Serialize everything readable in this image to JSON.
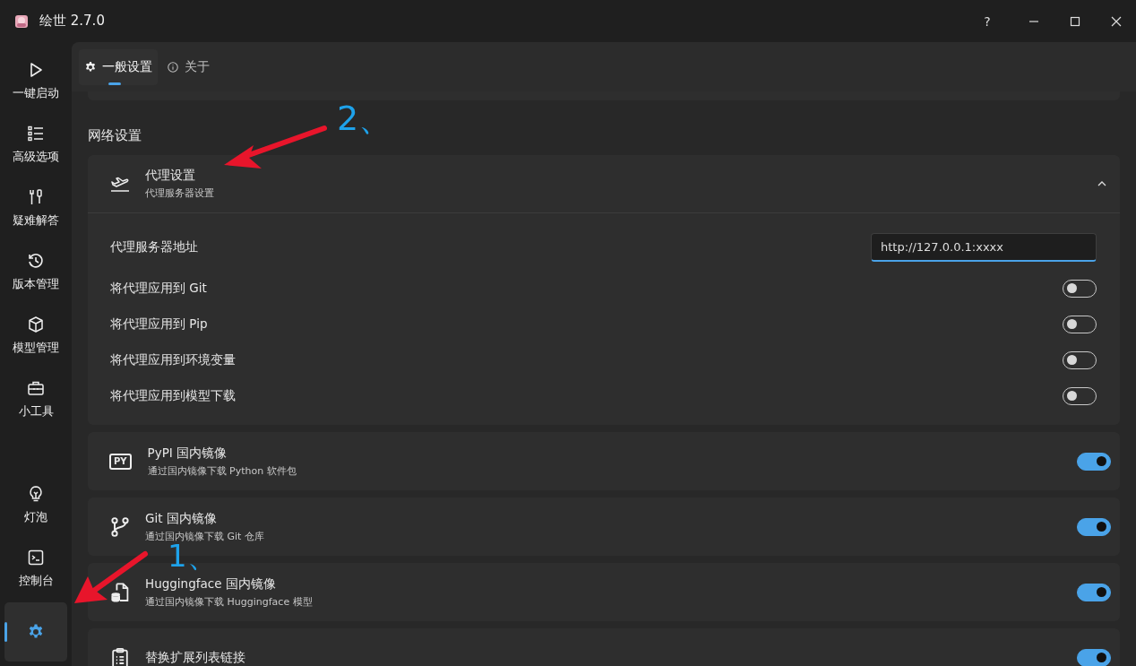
{
  "window": {
    "title": "绘世 2.7.0",
    "help": "?"
  },
  "sidebar": {
    "items": [
      {
        "label": "一键启动",
        "selected": false
      },
      {
        "label": "高级选项",
        "selected": false
      },
      {
        "label": "疑难解答",
        "selected": false
      },
      {
        "label": "版本管理",
        "selected": false
      },
      {
        "label": "模型管理",
        "selected": false
      },
      {
        "label": "小工具",
        "selected": false
      }
    ],
    "bottom_items": [
      {
        "label": "灯泡",
        "selected": false
      },
      {
        "label": "控制台",
        "selected": false
      },
      {
        "selected": true
      }
    ]
  },
  "tabs": [
    {
      "label": "一般设置",
      "selected": true
    },
    {
      "label": "关于",
      "selected": false
    }
  ],
  "section_title": "网络设置",
  "proxy": {
    "title": "代理设置",
    "subtitle": "代理服务器设置",
    "expanded": true,
    "address_label": "代理服务器地址",
    "address": {
      "value": "http://127.0.0.1:xxxx",
      "focused": true
    },
    "toggles": [
      {
        "label": "将代理应用到 Git",
        "on": false
      },
      {
        "label": "将代理应用到 Pip",
        "on": false
      },
      {
        "label": "将代理应用到环境变量",
        "on": false
      },
      {
        "label": "将代理应用到模型下载",
        "on": false
      }
    ]
  },
  "cards": [
    {
      "icon_text": "PY",
      "title": "PyPI 国内镜像",
      "subtitle": "通过国内镜像下载 Python 软件包",
      "on": true
    },
    {
      "title": "Git 国内镜像",
      "subtitle": "通过国内镜像下载 Git 仓库",
      "on": true
    },
    {
      "title": "Huggingface 国内镜像",
      "subtitle": "通过国内镜像下载 Huggingface 模型",
      "on": true
    },
    {
      "title": "替换扩展列表链接",
      "on": true
    }
  ],
  "annotations": [
    {
      "text": "2、"
    },
    {
      "text": "1、"
    }
  ]
}
